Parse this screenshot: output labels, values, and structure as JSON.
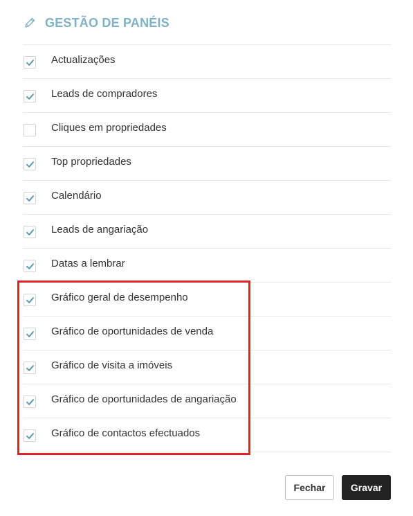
{
  "dialog": {
    "title": "GESTÃO DE PANÉIS",
    "title_icon": "pencil-icon",
    "accent_color": "#7fb2c2",
    "check_color": "#5b9ab0",
    "highlight_color": "#e0222b"
  },
  "panels": [
    {
      "label": "Actualizações",
      "checked": true
    },
    {
      "label": "Leads de compradores",
      "checked": true
    },
    {
      "label": "Cliques em propriedades",
      "checked": false
    },
    {
      "label": "Top propriedades",
      "checked": true
    },
    {
      "label": "Calendário",
      "checked": true
    },
    {
      "label": "Leads de angariação",
      "checked": true
    },
    {
      "label": "Datas a lembrar",
      "checked": true
    },
    {
      "label": "Gráfico geral de desempenho",
      "checked": true
    },
    {
      "label": "Gráfico de oportunidades de venda",
      "checked": true
    },
    {
      "label": "Gráfico de visita a imóveis",
      "checked": true
    },
    {
      "label": "Gráfico de oportunidades de angariação",
      "checked": true
    },
    {
      "label": "Gráfico de contactos efectuados",
      "checked": true
    }
  ],
  "buttons": {
    "close_label": "Fechar",
    "save_label": "Gravar"
  }
}
